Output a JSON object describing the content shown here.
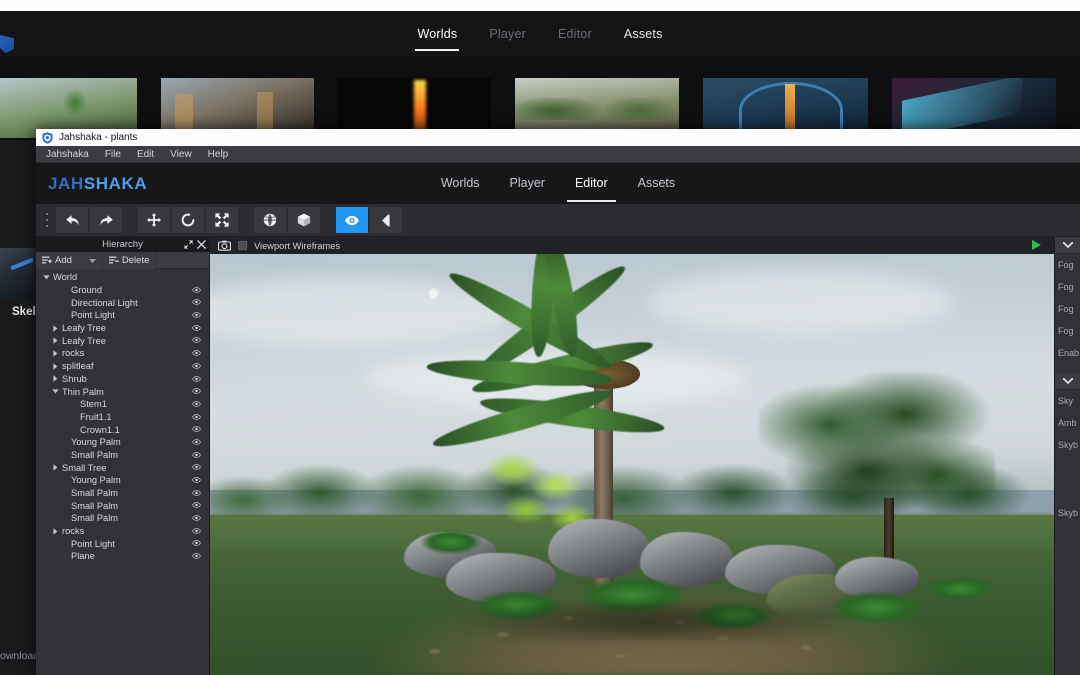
{
  "background_page": {
    "nav_tabs": [
      {
        "label": "Worlds",
        "state": "active"
      },
      {
        "label": "Player",
        "state": "dim"
      },
      {
        "label": "Editor",
        "state": "dim"
      },
      {
        "label": "Assets",
        "state": "bright"
      }
    ],
    "logo_icon": "jahshaka-shield-icon",
    "left_text": "Skele",
    "download_text": "ownload W",
    "thumbnails": [
      {
        "name": "world-thumb-plants"
      },
      {
        "name": "world-thumb-interior"
      },
      {
        "name": "world-thumb-fire"
      },
      {
        "name": "world-thumb-park"
      },
      {
        "name": "world-thumb-dome"
      },
      {
        "name": "world-thumb-abstract"
      }
    ]
  },
  "window": {
    "title": "Jahshaka - plants",
    "title_icon": "shield-icon",
    "menu": [
      "Jahshaka",
      "File",
      "Edit",
      "View",
      "Help"
    ]
  },
  "app": {
    "logo_first": "JAH",
    "logo_second": "SHAKA",
    "nav_tabs": [
      {
        "label": "Worlds",
        "active": false
      },
      {
        "label": "Player",
        "active": false
      },
      {
        "label": "Editor",
        "active": true
      },
      {
        "label": "Assets",
        "active": false
      }
    ],
    "accent_color": "#2196f3"
  },
  "toolbar": {
    "grip": "drag-handle-icon",
    "buttons": [
      {
        "name": "undo-button",
        "icon": "undo-arrow-icon",
        "active": false
      },
      {
        "name": "redo-button",
        "icon": "redo-arrow-icon",
        "active": false
      },
      {
        "name": "translate-tool-button",
        "icon": "move-arrows-icon",
        "active": false
      },
      {
        "name": "rotate-tool-button",
        "icon": "rotate-circle-icon",
        "active": false
      },
      {
        "name": "scale-tool-button",
        "icon": "scale-arrows-icon",
        "active": false
      },
      {
        "name": "global-space-button",
        "icon": "globe-icon",
        "active": false
      },
      {
        "name": "local-space-button",
        "icon": "cube-icon",
        "active": false
      },
      {
        "name": "visibility-button",
        "icon": "eye-icon",
        "active": true
      },
      {
        "name": "collapse-panel-button",
        "icon": "chevron-left-icon",
        "active": false
      }
    ]
  },
  "hierarchy": {
    "panel_title": "Hierarchy",
    "expand_icon": "expand-arrows-icon",
    "close_icon": "close-icon",
    "add_label": "Add",
    "add_icon": "add-list-icon",
    "add_caret": "chevron-down-icon",
    "delete_label": "Delete",
    "delete_icon": "delete-list-icon",
    "eye_icon": "eye-icon",
    "tree": [
      {
        "label": "World",
        "depth": 0,
        "arrow": "down",
        "eye": false
      },
      {
        "label": "Ground",
        "depth": 2,
        "arrow": "none",
        "eye": true
      },
      {
        "label": "Directional Light",
        "depth": 2,
        "arrow": "none",
        "eye": true
      },
      {
        "label": "Point Light",
        "depth": 2,
        "arrow": "none",
        "eye": true
      },
      {
        "label": "Leafy Tree",
        "depth": 1,
        "arrow": "right",
        "eye": true
      },
      {
        "label": "Leafy Tree",
        "depth": 1,
        "arrow": "right",
        "eye": true
      },
      {
        "label": "rocks",
        "depth": 1,
        "arrow": "right",
        "eye": true
      },
      {
        "label": "splitleaf",
        "depth": 1,
        "arrow": "right",
        "eye": true
      },
      {
        "label": "Shrub",
        "depth": 1,
        "arrow": "right",
        "eye": true
      },
      {
        "label": "Thin Palm",
        "depth": 1,
        "arrow": "down",
        "eye": true
      },
      {
        "label": "Stem1",
        "depth": 3,
        "arrow": "none",
        "eye": true
      },
      {
        "label": "Fruit1.1",
        "depth": 3,
        "arrow": "none",
        "eye": true
      },
      {
        "label": "Crown1.1",
        "depth": 3,
        "arrow": "none",
        "eye": true
      },
      {
        "label": "Young Palm",
        "depth": 2,
        "arrow": "none",
        "eye": true
      },
      {
        "label": "Small Palm",
        "depth": 2,
        "arrow": "none",
        "eye": true
      },
      {
        "label": "Small Tree",
        "depth": 1,
        "arrow": "right",
        "eye": true
      },
      {
        "label": "Young Palm",
        "depth": 2,
        "arrow": "none",
        "eye": true
      },
      {
        "label": "Small Palm",
        "depth": 2,
        "arrow": "none",
        "eye": true
      },
      {
        "label": "Small Palm",
        "depth": 2,
        "arrow": "none",
        "eye": true
      },
      {
        "label": "Small Palm",
        "depth": 2,
        "arrow": "none",
        "eye": true
      },
      {
        "label": "rocks",
        "depth": 1,
        "arrow": "right",
        "eye": true
      },
      {
        "label": "Point Light",
        "depth": 2,
        "arrow": "none",
        "eye": true
      },
      {
        "label": "Plane",
        "depth": 2,
        "arrow": "none",
        "eye": true
      }
    ]
  },
  "viewport_bar": {
    "camera_icon": "camera-icon",
    "wireframes_label": "Viewport Wireframes",
    "wireframes_checked": false,
    "play_icon": "play-icon",
    "play_color": "#2ebd5e"
  },
  "viewport": {
    "scene_description": "3D rendered tropical garden scene with palm tree, foliage and rocks"
  },
  "properties": {
    "sections": [
      {
        "collapse_icon": "chevron-down-icon",
        "rows": [
          "Fog",
          "Fog",
          "Fog",
          "Fog",
          "Enab"
        ]
      },
      {
        "collapse_icon": "chevron-down-icon",
        "rows": [
          "Sky",
          "Amb",
          "Skyb",
          "",
          "Skyb"
        ]
      }
    ]
  }
}
